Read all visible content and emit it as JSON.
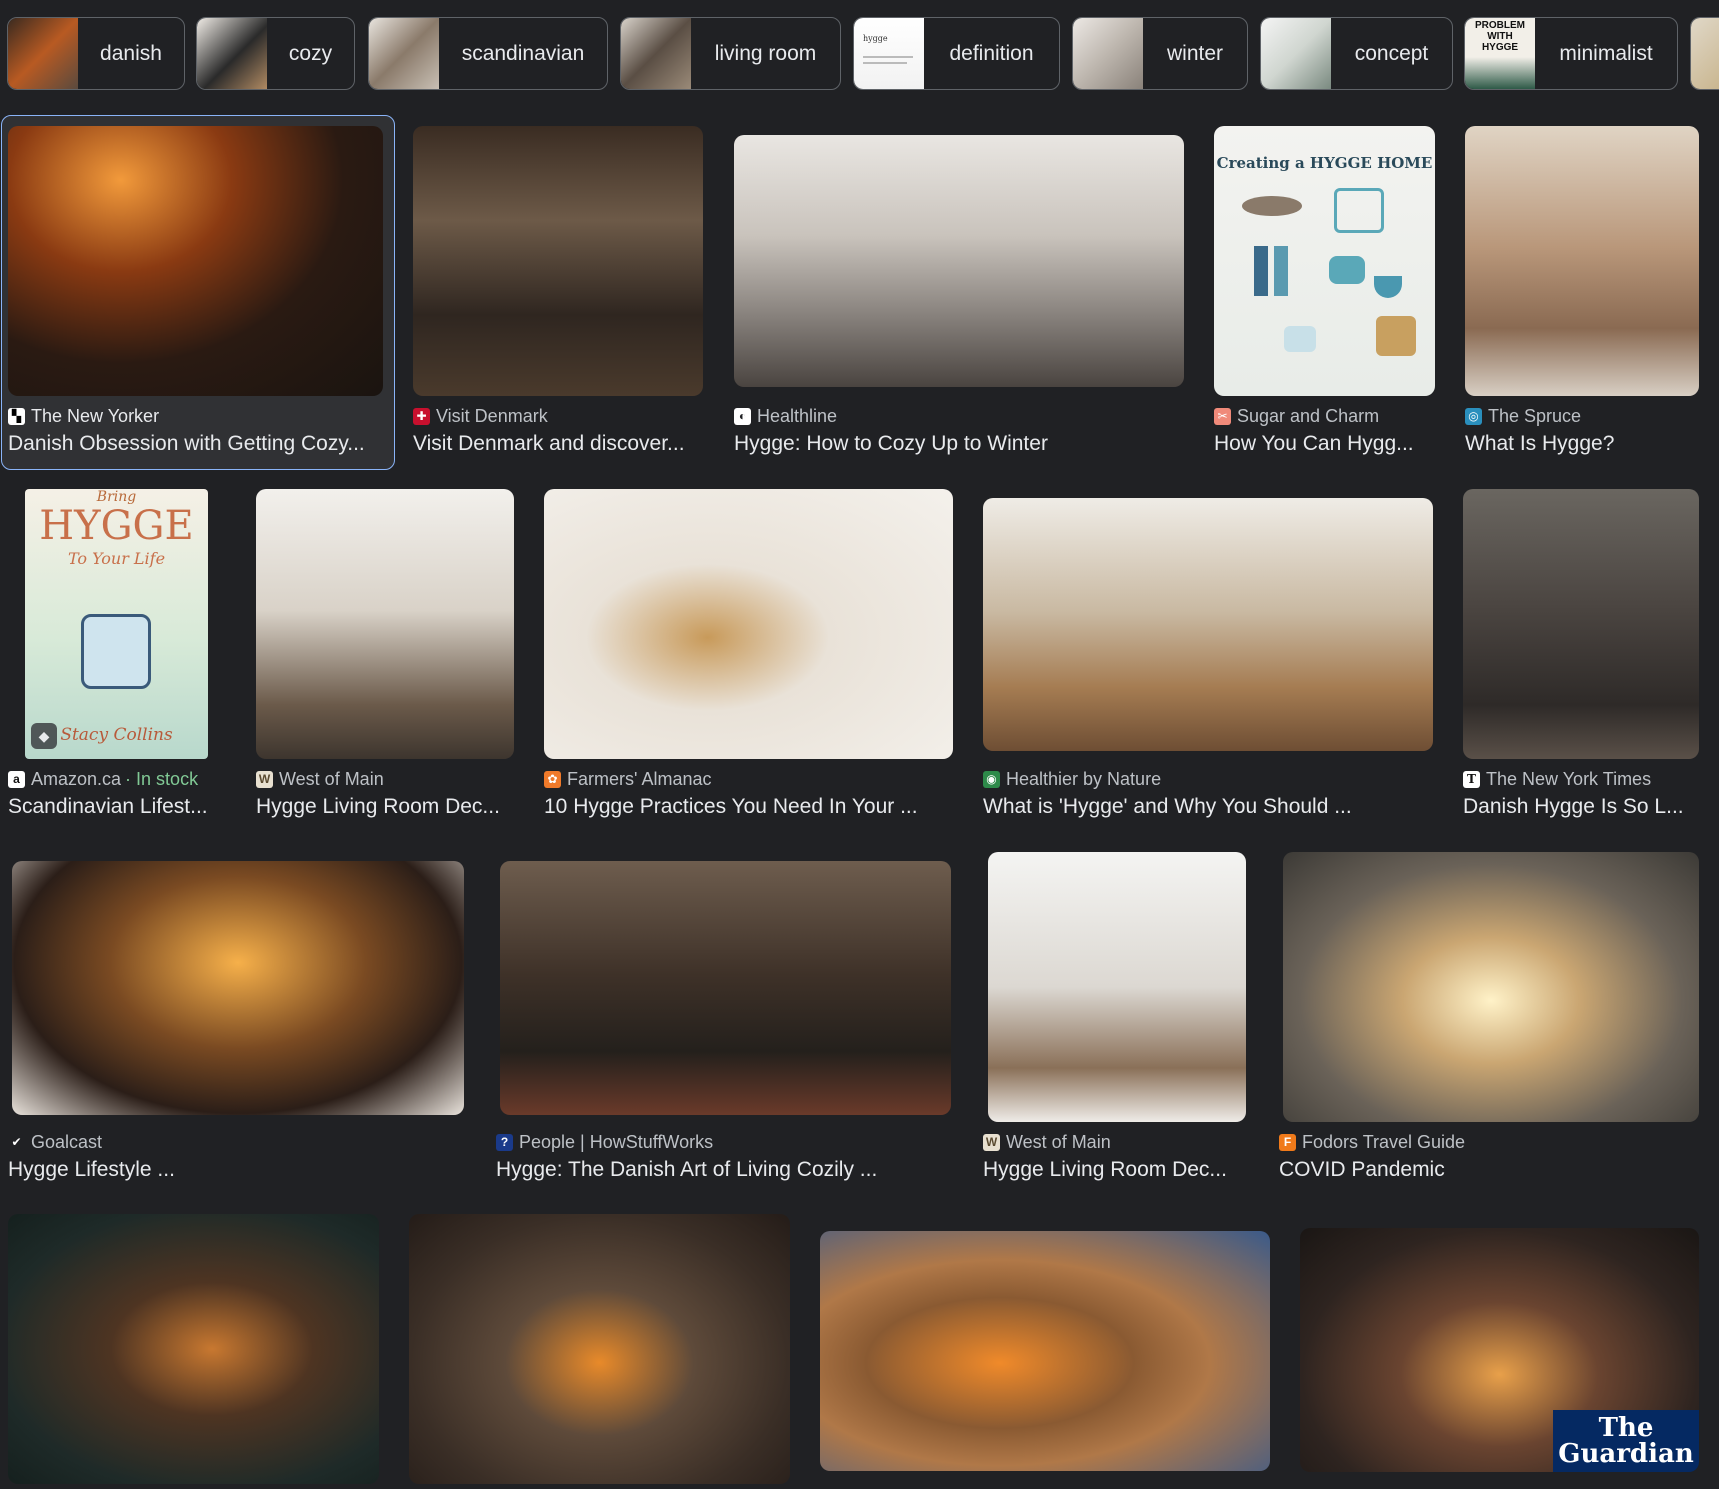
{
  "chips": [
    {
      "label": "danish"
    },
    {
      "label": "cozy"
    },
    {
      "label": "scandinavian"
    },
    {
      "label": "living room"
    },
    {
      "label": "definition"
    },
    {
      "label": "winter"
    },
    {
      "label": "concept"
    },
    {
      "label": "minimalist"
    }
  ],
  "chip_thumb_text": {
    "definition": "hygge",
    "minimalist": "PROBLEM WITH HYGGE"
  },
  "results": [
    {
      "source": "The New Yorker",
      "title": "Danish Obsession with Getting Cozy...",
      "favicon": "new-yorker-icon",
      "fav_color": "#ffffff"
    },
    {
      "source": "Visit Denmark",
      "title": "Visit Denmark and discover...",
      "favicon": "visit-denmark-icon",
      "fav_color": "#c8102e"
    },
    {
      "source": "Healthline",
      "title": "Hygge: How to Cozy Up to Winter",
      "favicon": "healthline-icon",
      "fav_color": "#ffffff"
    },
    {
      "source": "Sugar and Charm",
      "title": "How You Can Hygg...",
      "favicon": "sugar-charm-icon",
      "fav_color": "#f08a7a"
    },
    {
      "source": "The Spruce",
      "title": "What Is Hygge?",
      "favicon": "spruce-icon",
      "fav_color": "#2a8fbd"
    },
    {
      "source": "Amazon.ca",
      "stock": "· In stock",
      "title": "Scandinavian Lifest...",
      "favicon": "amazon-icon",
      "fav_color": "#ffffff"
    },
    {
      "source": "West of Main",
      "title": "Hygge Living Room Dec...",
      "favicon": "west-of-main-icon",
      "fav_color": "#e8e0d0"
    },
    {
      "source": "Farmers' Almanac",
      "title": "10 Hygge Practices You Need In Your ...",
      "favicon": "farmers-almanac-icon",
      "fav_color": "#f07a2a"
    },
    {
      "source": "Healthier by Nature",
      "title": "What is 'Hygge' and Why You Should ...",
      "favicon": "healthier-nature-icon",
      "fav_color": "#2e8a4a"
    },
    {
      "source": "The New York Times",
      "title": "Danish Hygge Is So L...",
      "favicon": "nyt-icon",
      "fav_color": "#ffffff"
    },
    {
      "source": "Goalcast",
      "title": "Hygge Lifestyle ...",
      "favicon": "goalcast-icon",
      "fav_color": "#202124"
    },
    {
      "source": "People | HowStuffWorks",
      "title": "Hygge: The Danish Art of Living Cozily ...",
      "favicon": "howstuffworks-icon",
      "fav_color": "#1a3a8a"
    },
    {
      "source": "West of Main",
      "title": "Hygge Living Room Dec...",
      "favicon": "west-of-main-icon",
      "fav_color": "#e8e0d0"
    },
    {
      "source": "Fodors Travel Guide",
      "title": "COVID Pandemic",
      "favicon": "fodors-icon",
      "fav_color": "#f07a1a"
    }
  ],
  "thumb_text": {
    "poster_title": "Creating a HYGGE HOME",
    "book_title": "HYGGE",
    "book_pre": "Bring",
    "book_sub": "To Your Life",
    "book_author": "Stacy Collins",
    "guardian": "The Guardian"
  }
}
